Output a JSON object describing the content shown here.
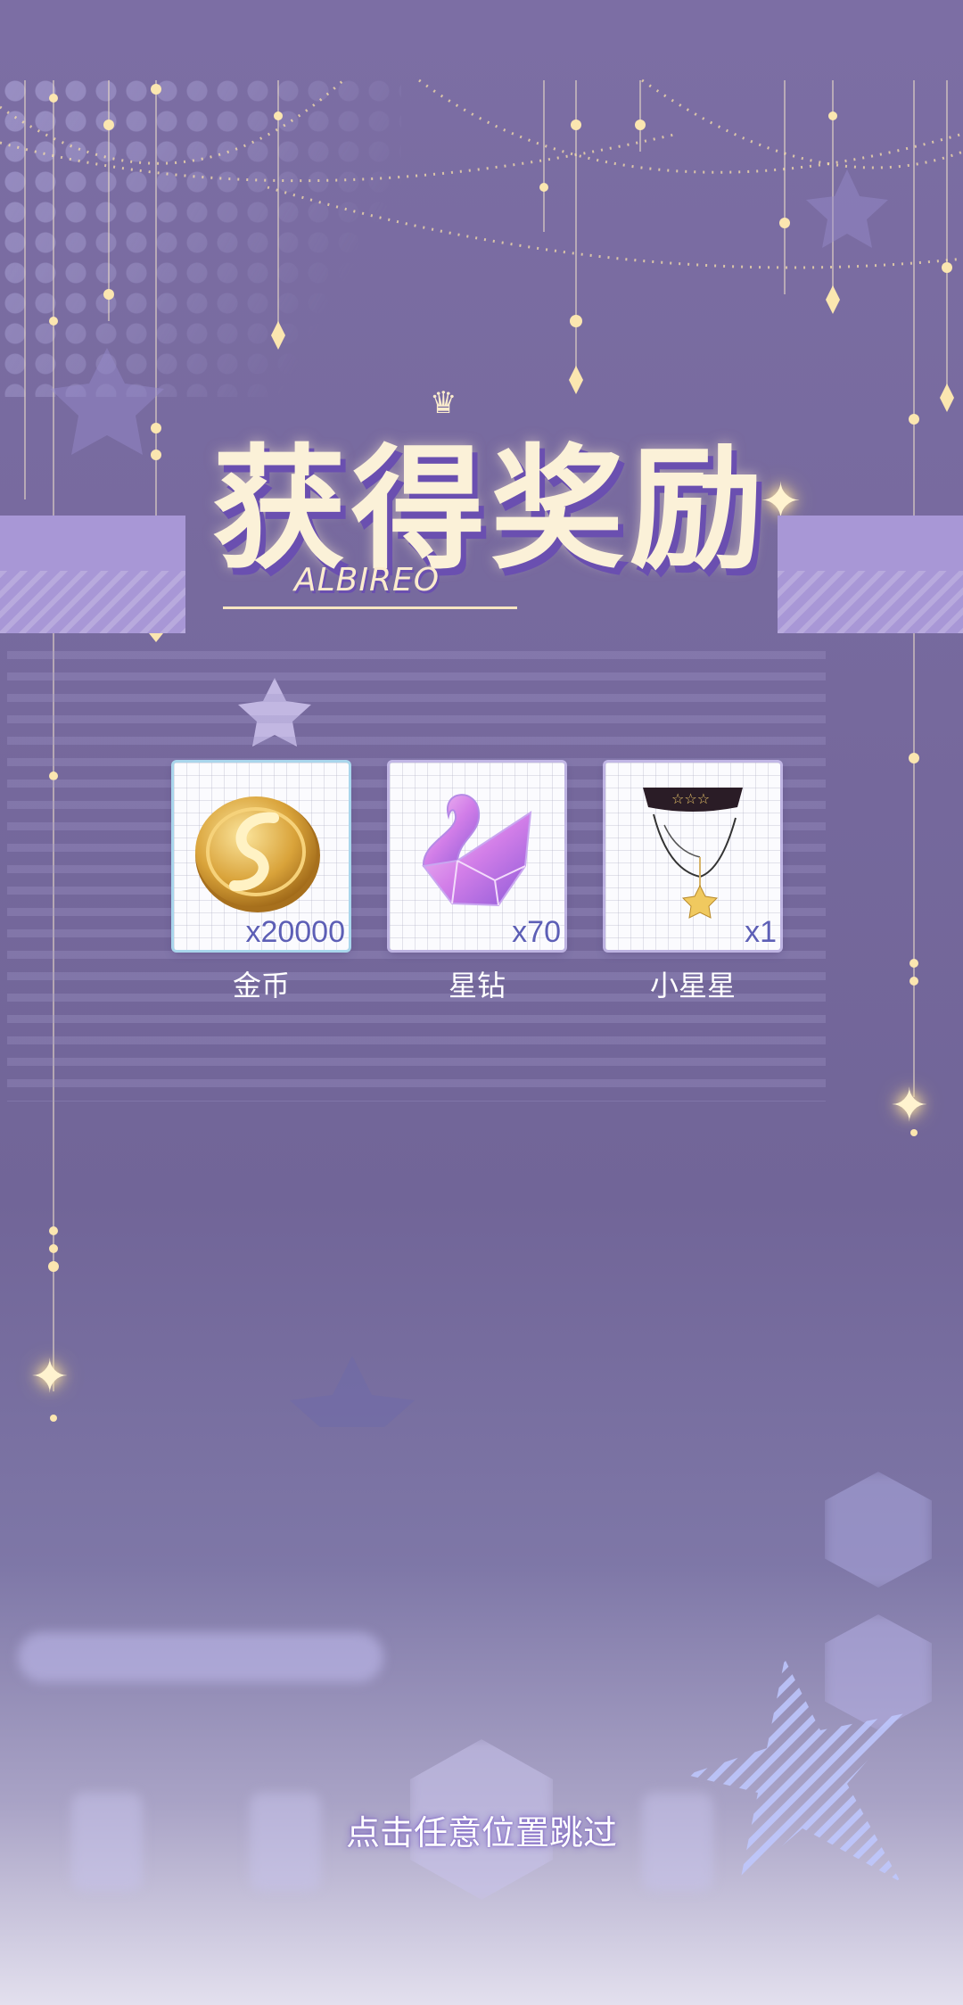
{
  "popup": {
    "title": "获得奖励",
    "subtitle": "ALBIREO"
  },
  "rewards": [
    {
      "name": "金币",
      "quantity": "x20000",
      "icon": "gold-coin-icon"
    },
    {
      "name": "星钻",
      "quantity": "x70",
      "icon": "crystal-swan-icon"
    },
    {
      "name": "小星星",
      "quantity": "x1",
      "icon": "star-choker-necklace-icon"
    }
  ],
  "skip_hint": "点击任意位置跳过",
  "colors": {
    "background": "#76699d",
    "title_text": "#fbf1d8",
    "title_shadow": "#6a4fb0",
    "ribbon": "#a897d6",
    "quantity_text": "#5d5fb6"
  }
}
